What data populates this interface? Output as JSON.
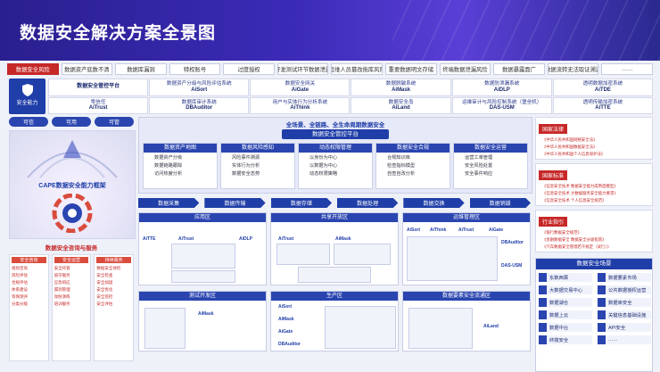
{
  "header": {
    "title": "数据安全解决方案全景图"
  },
  "risks": [
    "数据安全风险",
    "数据资产底数不清",
    "数据库漏洞",
    "特权账号",
    "过度授权",
    "开发测试环节数据泄露",
    "运维人员篡改拖库风险",
    "重要数据明文存储",
    "终端数据泄漏风险",
    "数据暴露面广",
    "数据流转无法取证溯源",
    "……"
  ],
  "capability": {
    "label": "安全能力",
    "cells": [
      {
        "l1": "数据安全管控平台",
        "l2": ""
      },
      {
        "l1": "数据资产分级与风险评估系统",
        "l2": "AiSort"
      },
      {
        "l1": "数据安全网关",
        "l2": "AiGate"
      },
      {
        "l1": "数据脱敏系统",
        "l2": "AiMask"
      },
      {
        "l1": "数据防泄漏系统",
        "l2": "AiDLP"
      },
      {
        "l1": "透明数据加密系统",
        "l2": "AiTDE"
      },
      {
        "l1": "零信任",
        "l2": "AiTrust"
      },
      {
        "l1": "数据库审计系统",
        "l2": "DBAuditor"
      },
      {
        "l1": "用户与实体行为分析系统",
        "l2": "AiThink"
      },
      {
        "l1": "数据安全岛",
        "l2": "AiLand"
      },
      {
        "l1": "运维审计与风险控制系统（堡垒机）",
        "l2": "DAS-USM"
      },
      {
        "l1": "数据安全咨询与服务",
        "l2": ""
      }
    ],
    "extra": [
      {
        "l1": "透明传输加密系统",
        "l2": "AiTTE"
      }
    ]
  },
  "left": {
    "pills": [
      "可信",
      "可用",
      "可管"
    ],
    "cape_title": "CAPE数据安全能力框架",
    "services_title": "数据安全咨询与服务",
    "service_cols": [
      {
        "head": "安全咨询",
        "items": [
          "规划咨询",
          "风险评估",
          "合规评估",
          "体系建设",
          "等保测评",
          "分类分级"
        ]
      },
      {
        "head": "安全运营",
        "items": [
          "安全托管",
          "值守服务",
          "应急响应",
          "漏洞管理",
          "攻防演练",
          "培训服务"
        ]
      },
      {
        "head": "持续服务",
        "items": [
          "数据安全体检",
          "安全检查",
          "安全加固",
          "安全优化",
          "安全巡检",
          "安全评估"
        ]
      }
    ]
  },
  "center": {
    "platform_tag": "全场景、全链路、全生命周期数据安全",
    "platform_name": "数据安全管控平台",
    "modules": [
      {
        "title": "数据资产地图",
        "items": [
          "数据资产分级",
          "数据链路跟踪",
          "访问热度分析"
        ]
      },
      {
        "title": "数据风险感知",
        "items": [
          "风险事件溯源",
          "实体行为分析",
          "数据安全态势"
        ]
      },
      {
        "title": "动态权限管理",
        "items": [
          "以身份为中心",
          "以数据为中心",
          "动态权限策略"
        ]
      },
      {
        "title": "数据安全合规",
        "items": [
          "合规知识库",
          "检查指标模型",
          "自查自改分析"
        ]
      },
      {
        "title": "数据安全运营",
        "items": [
          "运营工单管理",
          "安全风险处置",
          "安全事件响应"
        ]
      }
    ],
    "flow": [
      "数据采集",
      "数据传输",
      "数据存储",
      "数据处理",
      "数据交换",
      "数据销毁"
    ],
    "zones_top": [
      {
        "title": "应用区",
        "tags": [
          "AiTTE",
          "AiTrust",
          "AiDLP"
        ]
      },
      {
        "title": "共享开放区",
        "tags": [
          "AiTrust",
          "AiMask"
        ]
      },
      {
        "title": "运维管理区",
        "tags": [
          "AiSort",
          "AiThink",
          "AiTrust",
          "AiGate",
          "DBAuditor",
          "DAS-USM"
        ]
      }
    ],
    "zones_bottom": [
      {
        "title": "测试开发区",
        "tags": [
          "AiMask"
        ]
      },
      {
        "title": "生产区",
        "tags": [
          "AiSort",
          "AiMask",
          "AiGate",
          "DBAuditor"
        ]
      },
      {
        "title": "数据要素安全流通区",
        "tags": [
          "AiLand"
        ]
      }
    ]
  },
  "right": {
    "laws": {
      "head": "国家法律",
      "items": [
        "《中华人民共和国网络安全法》",
        "《中华人民共和国数据安全法》",
        "《中华人民共和国个人信息保护法》"
      ]
    },
    "standards": {
      "head": "国家标准",
      "items": [
        "《信息安全技术 数据安全能力成熟度模型》",
        "《信息安全技术 大数据服务安全能力要求》",
        "《信息安全技术 个人信息安全规范》"
      ]
    },
    "industry": {
      "head": "行业指引",
      "items": [
        "《银行数据安全规范》",
        "《金融数据安全 数据安全分级指南》",
        "《汽车数据安全管理若干规定（试行）》"
      ]
    },
    "scene_title": "数据安全场景",
    "scenes": [
      "东数西算",
      "数据要素市场",
      "大数据交易中心",
      "公共数据授权运营",
      "数据湖仓",
      "数据库安全",
      "数据上云",
      "关键信息基础设施",
      "数据中台",
      "API安全",
      "终端安全",
      "……"
    ]
  }
}
